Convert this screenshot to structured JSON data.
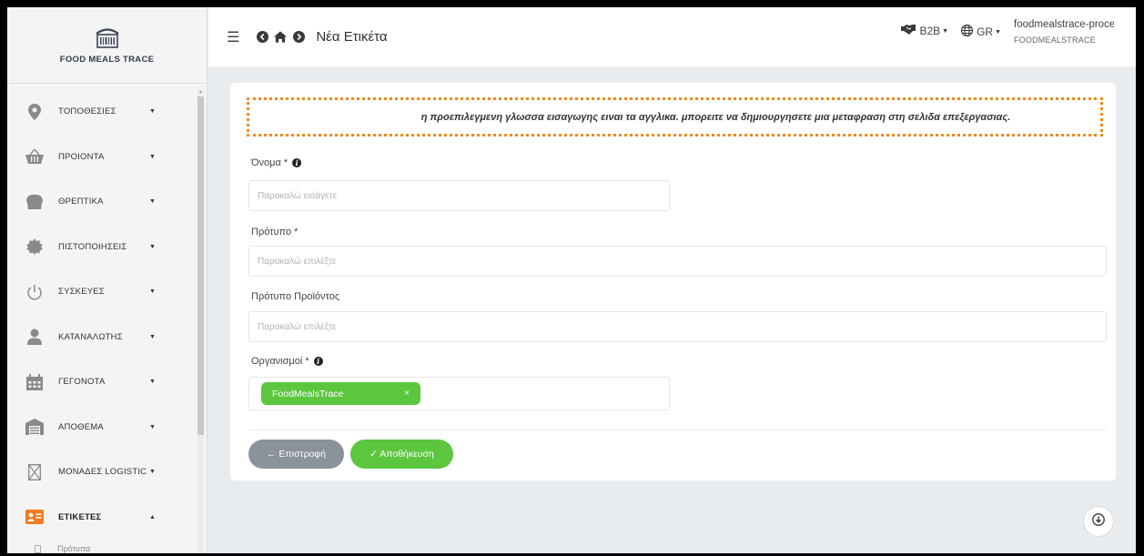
{
  "brand": {
    "name": "FOOD MEALS TRACE"
  },
  "sidebar": {
    "items": [
      {
        "label": "ΤΟΠΟΘΕΣΙΕΣ",
        "icon": "location-pin-icon"
      },
      {
        "label": "ΠΡΟΙΟΝΤΑ",
        "icon": "basket-icon"
      },
      {
        "label": "ΘΡΕΠΤΙΚΑ",
        "icon": "chef-hat-icon"
      },
      {
        "label": "ΠΙΣΤΟΠΟΙΗΣΕΙΣ",
        "icon": "certificate-seal-icon"
      },
      {
        "label": "ΣΥΣΚΕΥΕΣ",
        "icon": "power-icon"
      },
      {
        "label": "ΚΑΤΑΝΑΛΩΤΗΣ",
        "icon": "user-icon"
      },
      {
        "label": "ΓΕΓΟΝΟΤΑ",
        "icon": "calendar-icon"
      },
      {
        "label": "ΑΠΟΘΕΜΑ",
        "icon": "warehouse-icon"
      },
      {
        "label": "ΜΟΝΑΔΕΣ LOGISTIC",
        "icon": "box-icon"
      },
      {
        "label": "ΕΤΙΚΕΤΕΣ",
        "icon": "id-card-icon"
      }
    ],
    "submenu": {
      "label": "Πρότυπα"
    }
  },
  "topbar": {
    "title": "Νέα Ετικέτα",
    "b2b": "B2B",
    "lang": "GR",
    "user_name": "foodmealstrace-processc",
    "user_org": "FOODMEALSTRACE"
  },
  "form": {
    "notice": "η προεπιλεγμενη γλωσσα εισαγωγης ειναι τα αγγλικα. μπορειτε να δημιουργησετε μια μεταφραση στη σελιδα επεξεργασιας.",
    "name_label": "Όνομα *",
    "name_placeholder": "Παρακαλώ εισάγετε",
    "template_label": "Πρότυπο *",
    "template_placeholder": "Παρακαλώ επιλέξτε",
    "product_template_label": "Πρότυπο Προϊόντος",
    "product_template_placeholder": "Παρακαλώ επιλέξτε",
    "orgs_label": "Οργανισμοί *",
    "org_tag": "FoodMealsTrace",
    "back_button": "← Επιστροφή",
    "save_button": "✓ Αποθήκευση"
  },
  "colors": {
    "accent_green": "#5cc63f",
    "notice_border": "#f28a1a",
    "back_gray": "#8c929b",
    "active_icon_orange": "#f27b1e"
  }
}
